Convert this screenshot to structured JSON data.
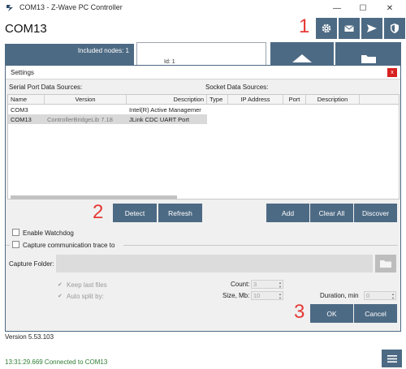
{
  "window": {
    "title": "COM13 - Z-Wave PC Controller",
    "minimize_glyph": "—",
    "maximize_glyph": "☐",
    "close_glyph": "✕"
  },
  "header": {
    "title": "COM13",
    "annotation": "1",
    "toolbar_icons": [
      "gear-icon",
      "mail-icon",
      "send-icon",
      "shield-icon"
    ]
  },
  "background": {
    "included_nodes": "Included nodes: 1",
    "node_id": "Id: 1"
  },
  "dialog": {
    "title": "Settings",
    "close_glyph": "x",
    "serial_label": "Serial Port Data Sources:",
    "socket_label": "Socket Data Sources:",
    "columns": {
      "name": "Name",
      "version": "Version",
      "description": "Description",
      "type": "Type",
      "ip": "IP Address",
      "port": "Port",
      "sdesc": "Description"
    },
    "rows": [
      {
        "name": "COM3",
        "version": "",
        "description": "Intel(R) Active Managemer"
      },
      {
        "name": "COM13",
        "version": "ControllerBridgeLib 7.18",
        "description": "JLink CDC UART Port"
      }
    ],
    "annotation_2": "2",
    "annotation_3": "3",
    "buttons": {
      "detect": "Detect",
      "refresh": "Refresh",
      "add": "Add",
      "clear_all": "Clear All",
      "discover": "Discover",
      "ok": "OK",
      "cancel": "Cancel"
    },
    "enable_watchdog": "Enable Watchdog",
    "capture_trace": "Capture communication trace to",
    "capture_folder_label": "Capture Folder:",
    "keep_last_files": "Keep last files",
    "auto_split_by": "Auto split by:",
    "count_label": "Count:",
    "count_value": "3",
    "size_label": "Size, Mb:",
    "size_value": "10",
    "duration_label": "Duration, min",
    "duration_value": "0"
  },
  "footer": {
    "version": "Version 5.53.103",
    "status": "13:31:29.669 Connected to COM13"
  },
  "colors": {
    "accent": "#4d6a84",
    "annotation": "#e53935",
    "status_green": "#2e7d32",
    "close_red": "#d7201f"
  }
}
